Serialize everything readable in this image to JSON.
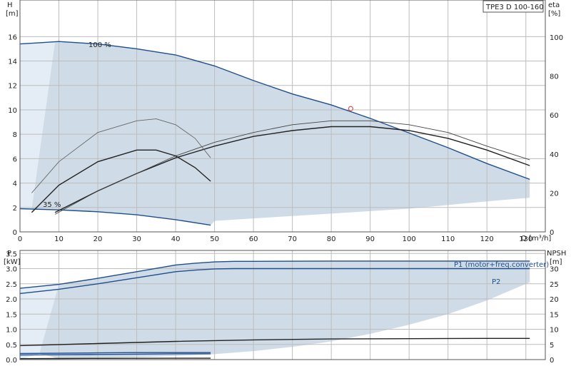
{
  "title_box": "TPE3 D 100-160",
  "chart_data": [
    {
      "type": "line",
      "panel": "head-efficiency",
      "x_axis": {
        "label": "Q [m³/h]",
        "range": [
          0,
          135
        ],
        "ticks": [
          0,
          10,
          20,
          30,
          40,
          50,
          60,
          70,
          80,
          90,
          100,
          110,
          120,
          130
        ]
      },
      "y_axis_left": {
        "label": "H",
        "unit": "[m]",
        "range": [
          0,
          19
        ],
        "ticks": [
          0,
          2,
          4,
          6,
          8,
          10,
          12,
          14,
          16
        ]
      },
      "y_axis_right": {
        "label": "eta",
        "unit": "[%]",
        "range": [
          0,
          119
        ],
        "ticks": [
          0,
          20,
          40,
          60,
          80,
          100
        ]
      },
      "grid": true,
      "annotations": [
        "100 %",
        "35 %"
      ],
      "operating_point": {
        "q": 85,
        "h": 10.1
      },
      "series": [
        {
          "name": "100 %",
          "axis": "left",
          "color": "#1f4e8c",
          "x": [
            0,
            5,
            10,
            20,
            30,
            40,
            50,
            60,
            70,
            80,
            90,
            100,
            110,
            120,
            131
          ],
          "y": [
            15.4,
            15.5,
            15.6,
            15.4,
            15.0,
            14.5,
            13.6,
            12.4,
            11.3,
            10.4,
            9.3,
            8.1,
            6.9,
            5.6,
            4.3
          ]
        },
        {
          "name": "35 %",
          "axis": "left",
          "color": "#1f4e8c",
          "x": [
            0,
            10,
            20,
            30,
            40,
            49
          ],
          "y": [
            1.9,
            1.8,
            1.65,
            1.4,
            1.0,
            0.55
          ]
        },
        {
          "name": "",
          "axis": "right",
          "color": "#222222",
          "x": [
            9,
            20,
            30,
            40,
            50,
            60,
            70,
            80,
            90,
            100,
            110,
            120,
            131
          ],
          "y": [
            10,
            21,
            30,
            38,
            44,
            49,
            52,
            54,
            54,
            52,
            48,
            42,
            34
          ]
        },
        {
          "name": "",
          "axis": "right",
          "color": "#444444",
          "x": [
            9,
            20,
            30,
            40,
            50,
            60,
            70,
            80,
            90,
            100,
            110,
            120,
            131
          ],
          "y": [
            9,
            21,
            30,
            39,
            46,
            51,
            55,
            57,
            57,
            55,
            51,
            44,
            37
          ]
        },
        {
          "name": "",
          "axis": "right",
          "color": "#222222",
          "x": [
            3,
            10,
            20,
            30,
            35,
            40,
            45,
            49
          ],
          "y": [
            10,
            24,
            36,
            42,
            42,
            39,
            33,
            26
          ]
        },
        {
          "name": "",
          "axis": "right",
          "color": "#666666",
          "x": [
            3,
            10,
            20,
            30,
            35,
            40,
            45,
            49
          ],
          "y": [
            20,
            36,
            51,
            57,
            58,
            55,
            48,
            38
          ]
        }
      ],
      "areas": [
        {
          "name": "operating-range",
          "color": "#cfdce7",
          "upper": {
            "x": [
              3,
              9,
              20,
              30,
              40,
              50,
              60,
              70,
              80,
              90,
              100,
              110,
              120,
              131
            ],
            "y": [
              1.9,
              15.6,
              15.4,
              15.0,
              14.5,
              13.6,
              12.4,
              11.3,
              10.4,
              9.3,
              8.1,
              6.9,
              5.6,
              4.3
            ]
          },
          "lower": {
            "x": [
              131,
              120,
              110,
              100,
              90,
              80,
              70,
              60,
              50,
              49,
              40,
              30,
              20,
              10,
              3
            ],
            "y": [
              2.8,
              2.5,
              2.2,
              1.9,
              1.7,
              1.5,
              1.3,
              1.1,
              0.9,
              0.55,
              1.0,
              1.4,
              1.65,
              1.8,
              1.9
            ]
          }
        },
        {
          "name": "light-wedge",
          "color": "#e4edf5",
          "upper": {
            "x": [
              0,
              9
            ],
            "y": [
              15.4,
              15.6
            ]
          },
          "lower": {
            "x": [
              9,
              3,
              0
            ],
            "y": [
              15.6,
              1.9,
              1.9
            ]
          }
        }
      ]
    },
    {
      "type": "line",
      "panel": "power-npsh",
      "x_axis": {
        "label": "",
        "range": [
          0,
          135
        ],
        "ticks": []
      },
      "y_axis_left": {
        "label": "P",
        "unit": "[kW]",
        "range": [
          0,
          3.6
        ],
        "ticks": [
          0,
          0.5,
          1.0,
          1.5,
          2.0,
          2.5,
          3.0,
          3.5
        ]
      },
      "y_axis_right": {
        "label": "NPSH",
        "unit": "[m]",
        "range": [
          0,
          36
        ],
        "ticks": [
          0,
          5,
          10,
          15,
          20,
          25,
          30
        ]
      },
      "grid": true,
      "series": [
        {
          "name": "P1 (motor+freq.converter)",
          "axis": "left",
          "color": "#1f4e8c",
          "x": [
            0,
            10,
            20,
            30,
            40,
            45,
            50,
            55,
            60,
            80,
            100,
            120,
            131
          ],
          "y": [
            2.35,
            2.48,
            2.68,
            2.9,
            3.12,
            3.18,
            3.22,
            3.24,
            3.24,
            3.25,
            3.25,
            3.25,
            3.25
          ]
        },
        {
          "name": "P2",
          "axis": "left",
          "color": "#1f4e8c",
          "x": [
            0,
            10,
            20,
            30,
            40,
            45,
            50,
            55,
            60,
            80,
            100,
            120,
            131
          ],
          "y": [
            2.18,
            2.32,
            2.5,
            2.7,
            2.9,
            2.95,
            2.99,
            3.0,
            3.0,
            3.0,
            3.0,
            3.0,
            3.0
          ]
        },
        {
          "name": "",
          "axis": "right",
          "color": "#222222",
          "x": [
            0,
            20,
            40,
            60,
            80,
            100,
            120,
            131
          ],
          "y": [
            4.6,
            5.3,
            6.0,
            6.5,
            6.8,
            6.9,
            7.0,
            7.0
          ]
        },
        {
          "name": "",
          "axis": "left",
          "color": "#1f4e8c",
          "x": [
            0,
            10,
            20,
            30,
            40,
            49
          ],
          "y": [
            0.2,
            0.21,
            0.22,
            0.23,
            0.23,
            0.23
          ]
        },
        {
          "name": "",
          "axis": "left",
          "color": "#1f4e8c",
          "x": [
            0,
            10,
            20,
            30,
            40,
            49
          ],
          "y": [
            0.15,
            0.16,
            0.17,
            0.18,
            0.19,
            0.19
          ]
        },
        {
          "name": "",
          "axis": "right",
          "color": "#222222",
          "x": [
            0,
            10,
            20,
            30,
            40,
            49
          ],
          "y": [
            0.3,
            0.35,
            0.4,
            0.42,
            0.45,
            0.45
          ]
        }
      ],
      "areas": [
        {
          "name": "operating-range",
          "color": "#cfdce7",
          "upper": {
            "x": [
              0,
              10,
              20,
              30,
              40,
              45,
              50,
              55,
              60,
              80,
              100,
              120,
              131
            ],
            "y": [
              2.35,
              2.48,
              2.68,
              2.9,
              3.12,
              3.18,
              3.22,
              3.24,
              3.24,
              3.25,
              3.25,
              3.25,
              3.25
            ]
          },
          "lower": {
            "x": [
              131,
              120,
              110,
              100,
              90,
              80,
              70,
              60,
              50,
              40,
              30,
              20,
              10,
              5,
              0
            ],
            "y": [
              2.55,
              1.95,
              1.5,
              1.15,
              0.85,
              0.6,
              0.42,
              0.28,
              0.18,
              0.12,
              0.08,
              0.05,
              0.03,
              0.2,
              0.0
            ]
          }
        },
        {
          "name": "light-wedge",
          "color": "#e4edf5",
          "upper": {
            "x": [
              0,
              10
            ],
            "y": [
              2.35,
              2.48
            ]
          },
          "lower": {
            "x": [
              10,
              5,
              0
            ],
            "y": [
              2.48,
              0.2,
              0.0
            ]
          }
        }
      ]
    }
  ]
}
